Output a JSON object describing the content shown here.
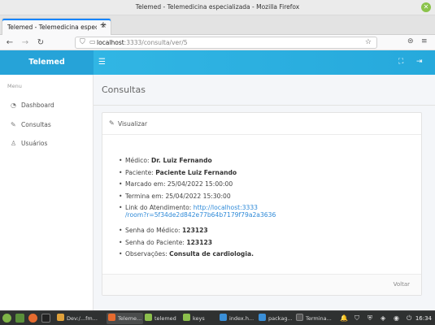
{
  "window": {
    "title": "Telemed - Telemedicina especializada - Mozilla Firefox",
    "close_glyph": "✕"
  },
  "browser": {
    "tab_title": "Telemed - Telemedicina especia",
    "tab_close": "×",
    "new_tab": "+",
    "url_host": "localhost",
    "url_rest": ":3333/consulta/ver/5",
    "icons": [
      "back-icon",
      "forward-icon",
      "reload-icon",
      "shield-icon",
      "lock-icon",
      "star-icon",
      "pocket-icon",
      "menu-icon"
    ]
  },
  "app": {
    "brand": "Telemed",
    "accent": "#2eb0e0"
  },
  "sidebar": {
    "menu_title": "Menu",
    "items": [
      {
        "label": "Dashboard",
        "icon": "dashboard-icon"
      },
      {
        "label": "Consultas",
        "icon": "edit-icon"
      },
      {
        "label": "Usuários",
        "icon": "user-icon"
      }
    ]
  },
  "page": {
    "title": "Consultas",
    "card_title": "Visualizar",
    "back_label": "Voltar",
    "details": {
      "medico_label": "Médico: ",
      "medico_value": "Dr. Luiz Fernando",
      "paciente_label": "Paciente: ",
      "paciente_value": "Paciente Luiz Fernando",
      "marcado_label": "Marcado em: ",
      "marcado_value": "25/04/2022 15:00:00",
      "termina_label": "Termina em: ",
      "termina_value": "25/04/2022 15:30:00",
      "link_label": "Link do Atendimento: ",
      "link_value_1": "http://localhost:3333",
      "link_value_2": "/room?r=5f34de2d842e77b64b7179f79a2a3636",
      "senha_medico_label": "Senha do Médico: ",
      "senha_medico_value": "123123",
      "senha_paciente_label": "Senha do Paciente: ",
      "senha_paciente_value": "123123",
      "obs_label": "Observações: ",
      "obs_value": "Consulta de cardiologia."
    }
  },
  "taskbar": {
    "items": [
      {
        "label": "Dev:/...fm...",
        "color": "#e0a13a"
      },
      {
        "label": "Teleme...",
        "color": "#e66b2f"
      },
      {
        "label": "telemed",
        "color": "#8cbf4c"
      },
      {
        "label": "keys",
        "color": "#8cbf4c"
      },
      {
        "label": "index.h...",
        "color": "#3a8fd8"
      },
      {
        "label": "packag...",
        "color": "#3a8fd8"
      },
      {
        "label": "Termina...",
        "color": "#444"
      }
    ],
    "clock": "16:34"
  }
}
